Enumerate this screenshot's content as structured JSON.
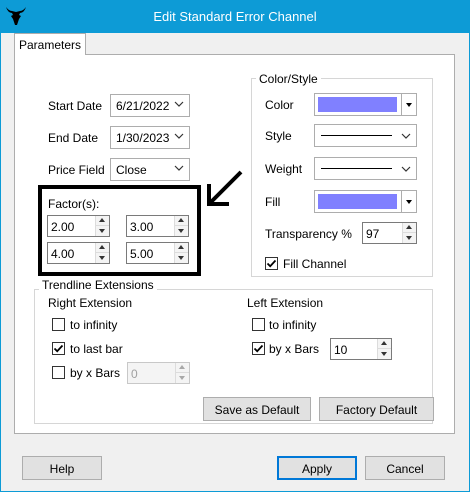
{
  "window": {
    "title": "Edit Standard Error Channel"
  },
  "tabs": [
    {
      "label": "Parameters"
    }
  ],
  "params": {
    "start_date_label": "Start Date",
    "start_date_value": "6/21/2022",
    "end_date_label": "End Date",
    "end_date_value": "1/30/2023",
    "price_field_label": "Price Field",
    "price_field_value": "Close",
    "factors_label": "Factor(s):",
    "factors": [
      "2.00",
      "3.00",
      "4.00",
      "5.00"
    ]
  },
  "color_style": {
    "legend": "Color/Style",
    "color_label": "Color",
    "color_value": "#8080ff",
    "style_label": "Style",
    "weight_label": "Weight",
    "fill_label": "Fill",
    "fill_value": "#8080ff",
    "transparency_label": "Transparency %",
    "transparency_value": "97",
    "fill_channel_label": "Fill Channel",
    "fill_channel_checked": true
  },
  "trendline": {
    "legend": "Trendline Extensions",
    "right": {
      "title": "Right Extension",
      "to_infinity_label": "to infinity",
      "to_infinity_checked": false,
      "to_last_bar_label": "to last bar",
      "to_last_bar_checked": true,
      "by_x_bars_label": "by x Bars",
      "by_x_bars_checked": false,
      "by_x_bars_value": "0"
    },
    "left": {
      "title": "Left Extension",
      "to_infinity_label": "to infinity",
      "to_infinity_checked": false,
      "by_x_bars_label": "by x Bars",
      "by_x_bars_checked": true,
      "by_x_bars_value": "10"
    }
  },
  "buttons": {
    "save_default": "Save as Default",
    "factory_default": "Factory Default",
    "help": "Help",
    "apply": "Apply",
    "cancel": "Cancel"
  },
  "colors": {
    "titlebar": "#0d9bd6",
    "swatch": "#8080ff"
  },
  "icons": {
    "app": "bull-head-icon",
    "annotation": "arrow-pointer-icon"
  }
}
